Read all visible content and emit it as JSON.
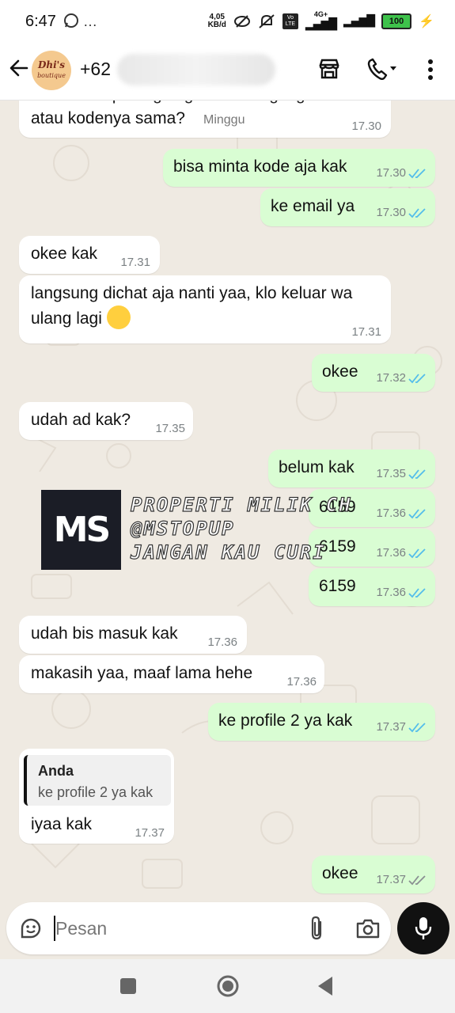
{
  "status_bar": {
    "time": "6:47",
    "extra": "…",
    "net_speed_value": "4,05",
    "net_speed_unit": "KB/d",
    "volte": "Vo LTE",
    "network": "4G+",
    "battery": "100"
  },
  "header": {
    "avatar_line1": "Dhi's",
    "avatar_line2": "boutique",
    "contact_prefix": "+62",
    "icons": [
      "back-arrow-icon",
      "shop-icon",
      "phone-icon",
      "more-vertical-icon"
    ]
  },
  "colors": {
    "incoming": "#ffffff",
    "outgoing": "#d9fdd3",
    "read_tick": "#53bdeb",
    "chat_bg": "#efeae2"
  },
  "messages": [
    {
      "dir": "in",
      "text1": "kak maaf hpku ngelag. bisa ulang login?",
      "text2": "atau kodenya sama?",
      "label": "Minggu",
      "time": "17.30"
    },
    {
      "dir": "out",
      "text": "bisa minta kode aja kak",
      "time": "17.30",
      "status": "read"
    },
    {
      "dir": "out",
      "text": "ke email ya",
      "time": "17.30",
      "status": "read"
    },
    {
      "dir": "in",
      "text": "okee kak",
      "time": "17.31"
    },
    {
      "dir": "in",
      "text1": "langsung dichat aja nanti yaa, klo keluar wa",
      "text2": "ulang lagi",
      "time": "17.31"
    },
    {
      "dir": "out",
      "text": "okee",
      "time": "17.32",
      "status": "read"
    },
    {
      "dir": "in",
      "text": "udah ad kak?",
      "time": "17.35"
    },
    {
      "dir": "out",
      "text": "belum kak",
      "time": "17.35",
      "status": "read"
    },
    {
      "dir": "out",
      "text": "6159",
      "time": "17.36",
      "status": "read"
    },
    {
      "dir": "out",
      "text": "6159",
      "time": "17.36",
      "status": "read"
    },
    {
      "dir": "out",
      "text": "6159",
      "time": "17.36",
      "status": "read"
    },
    {
      "dir": "in",
      "text": "udah bis masuk kak",
      "time": "17.36"
    },
    {
      "dir": "in",
      "text": "makasih yaa, maaf lama hehe",
      "time": "17.36"
    },
    {
      "dir": "out",
      "text": "ke profile 2 ya kak",
      "time": "17.37",
      "status": "read"
    },
    {
      "dir": "in",
      "quote_author": "Anda",
      "quote_text": "ke profile 2 ya kak",
      "text": "iyaa kak",
      "time": "17.37"
    },
    {
      "dir": "out",
      "text": "okee",
      "time": "17.37",
      "status": "delivered"
    }
  ],
  "watermark": {
    "logo": "MS",
    "line1": "PROPERTI MILIK CH",
    "line2": "@MSTOPUP",
    "line3": "JANGAN KAU CURI"
  },
  "composer": {
    "placeholder": "Pesan",
    "icons": [
      "sticker-icon",
      "attach-icon",
      "camera-icon",
      "mic-icon"
    ]
  },
  "navbar": {
    "icons": [
      "recents-square-icon",
      "home-circle-icon",
      "back-triangle-icon"
    ]
  }
}
